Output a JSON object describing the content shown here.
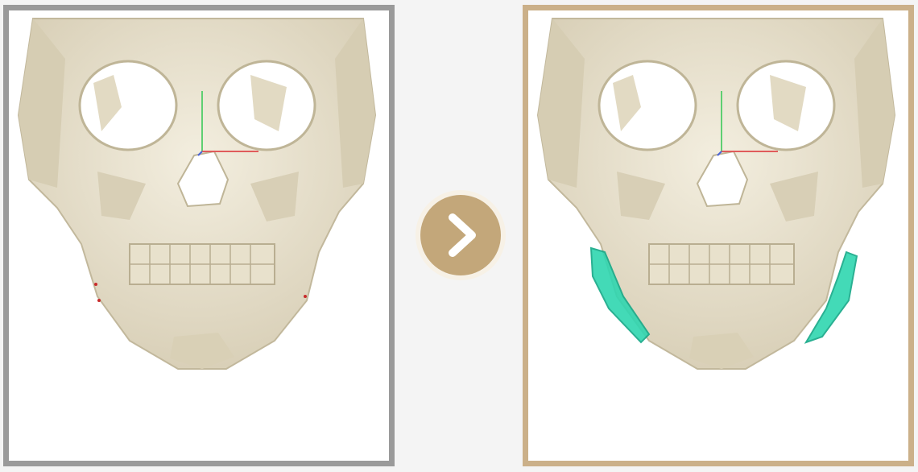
{
  "panels": [
    {
      "id": "before",
      "state": "before",
      "frame_color": "#9a9a9a",
      "highlight": false
    },
    {
      "id": "after",
      "state": "after",
      "frame_color": "#cbb089",
      "highlight": true,
      "highlight_color": "#2fd6b0"
    }
  ],
  "next_button": {
    "icon": "chevron-right-icon",
    "color": "#c3a77a",
    "ring_color": "#f7f1e6"
  },
  "colors": {
    "background": "#f4f4f4",
    "bone": "#ebe4d0",
    "bone_shadow": "#cdc4aa",
    "axis_red": "#e05b5b",
    "axis_green": "#5fcf72",
    "axis_blue": "#4a63d8"
  }
}
